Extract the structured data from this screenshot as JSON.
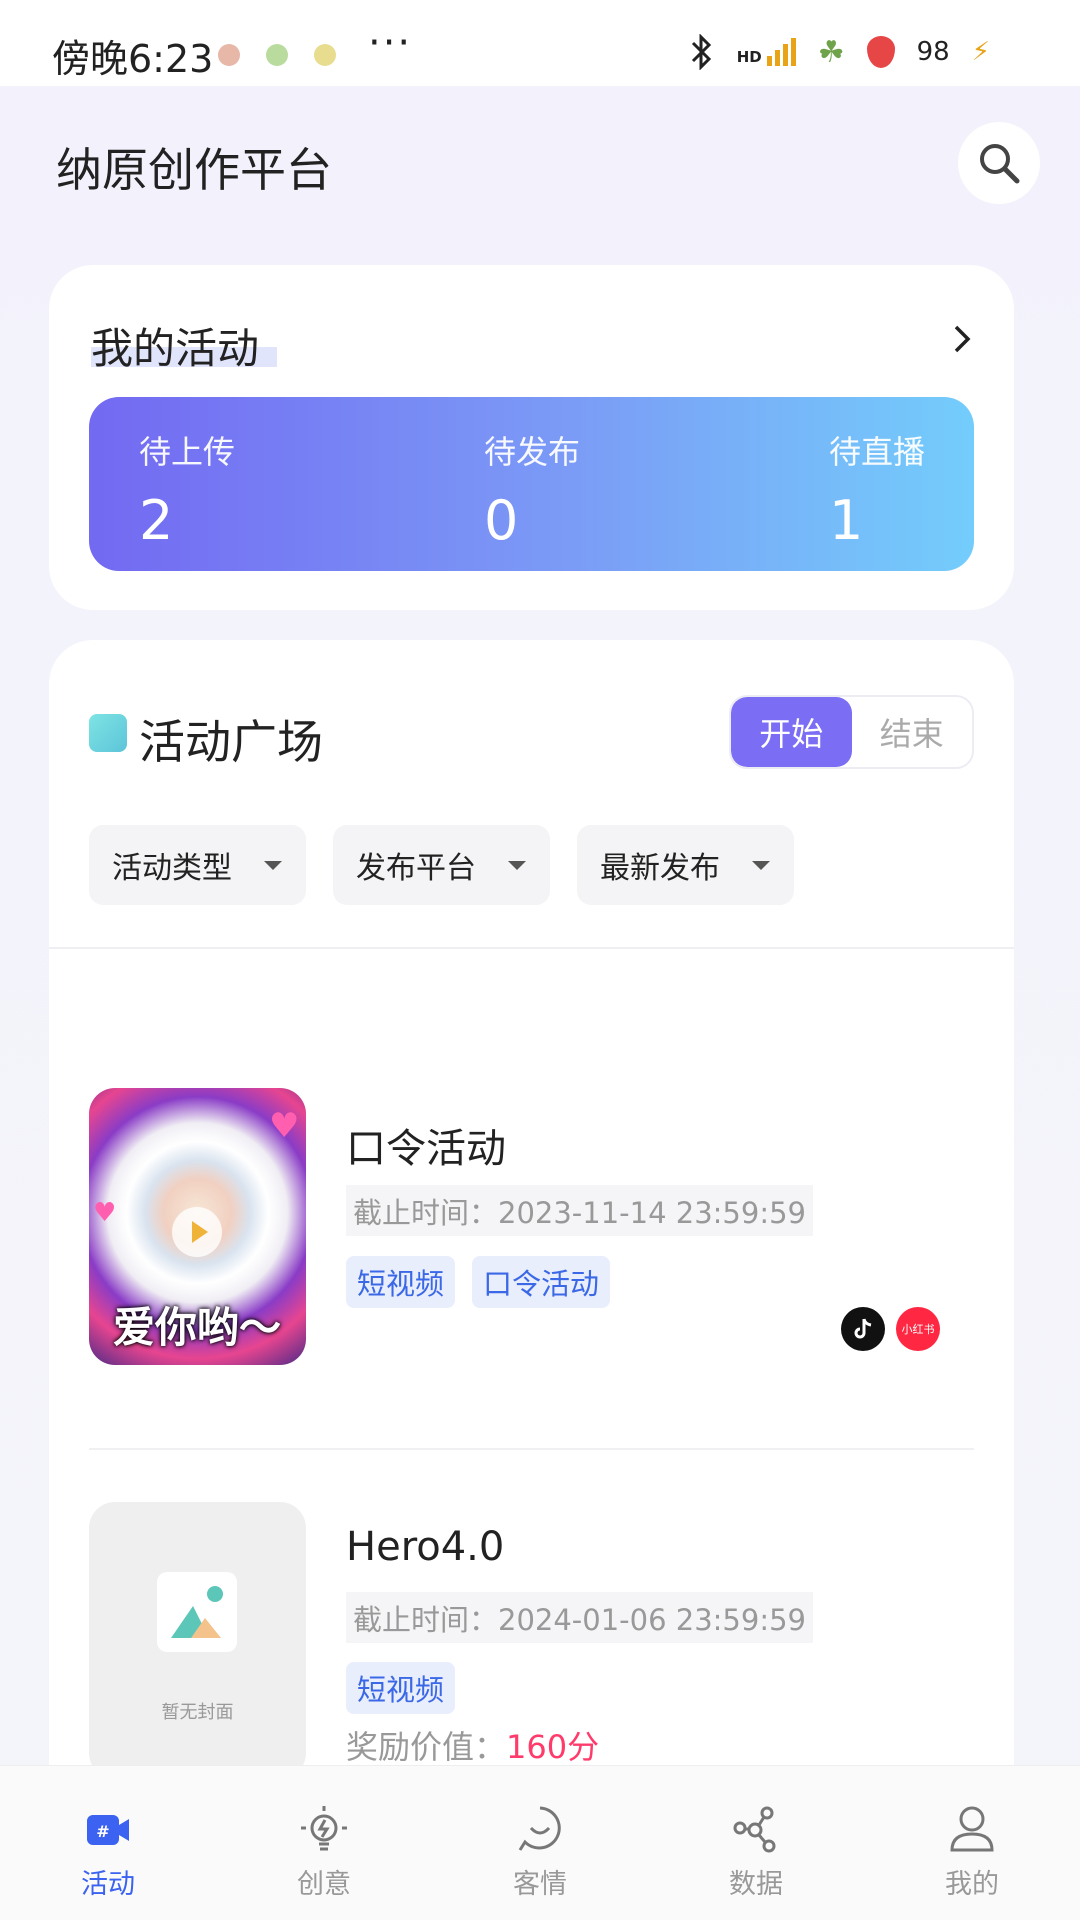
{
  "status_bar": {
    "time": "傍晚6:23",
    "more": "···",
    "signal_label": "HD",
    "battery": "98"
  },
  "header": {
    "title": "纳原创作平台",
    "search_icon": "search-icon"
  },
  "my_activity": {
    "title": "我的活动",
    "stats": [
      {
        "label": "待上传",
        "value": "2"
      },
      {
        "label": "待发布",
        "value": "0"
      },
      {
        "label": "待直播",
        "value": "1"
      }
    ]
  },
  "square": {
    "title": "活动广场",
    "toggle": {
      "start": "开始",
      "end": "结束",
      "selected": "开始"
    },
    "filters": [
      "活动类型",
      "发布平台",
      "最新发布"
    ],
    "items": [
      {
        "title": "口令活动",
        "deadline": "截止时间：2023-11-14 23:59:59",
        "tags": [
          "短视频",
          "口令活动"
        ],
        "thumb_caption": "爱你哟～",
        "platforms": [
          "douyin",
          "xiaohongshu"
        ],
        "xhs_label": "小红书"
      },
      {
        "title": "Hero4.0",
        "deadline": "截止时间：2024-01-06 23:59:59",
        "tags": [
          "短视频"
        ],
        "thumb_placeholder": "暂无封面",
        "reward_label": "奖励价值：",
        "reward_value": "160分"
      }
    ]
  },
  "tabbar": {
    "tabs": [
      {
        "label": "活动",
        "icon": "activity-icon",
        "active": true
      },
      {
        "label": "创意",
        "icon": "lightbulb-icon",
        "active": false
      },
      {
        "label": "客情",
        "icon": "smile-icon",
        "active": false
      },
      {
        "label": "数据",
        "icon": "share-nodes-icon",
        "active": false
      },
      {
        "label": "我的",
        "icon": "person-icon",
        "active": false
      }
    ]
  },
  "colors": {
    "accent": "#7b6ef5",
    "tab_active": "#3b62f0",
    "tag_text": "#3b68e6",
    "reward": "#ff3b6b"
  }
}
